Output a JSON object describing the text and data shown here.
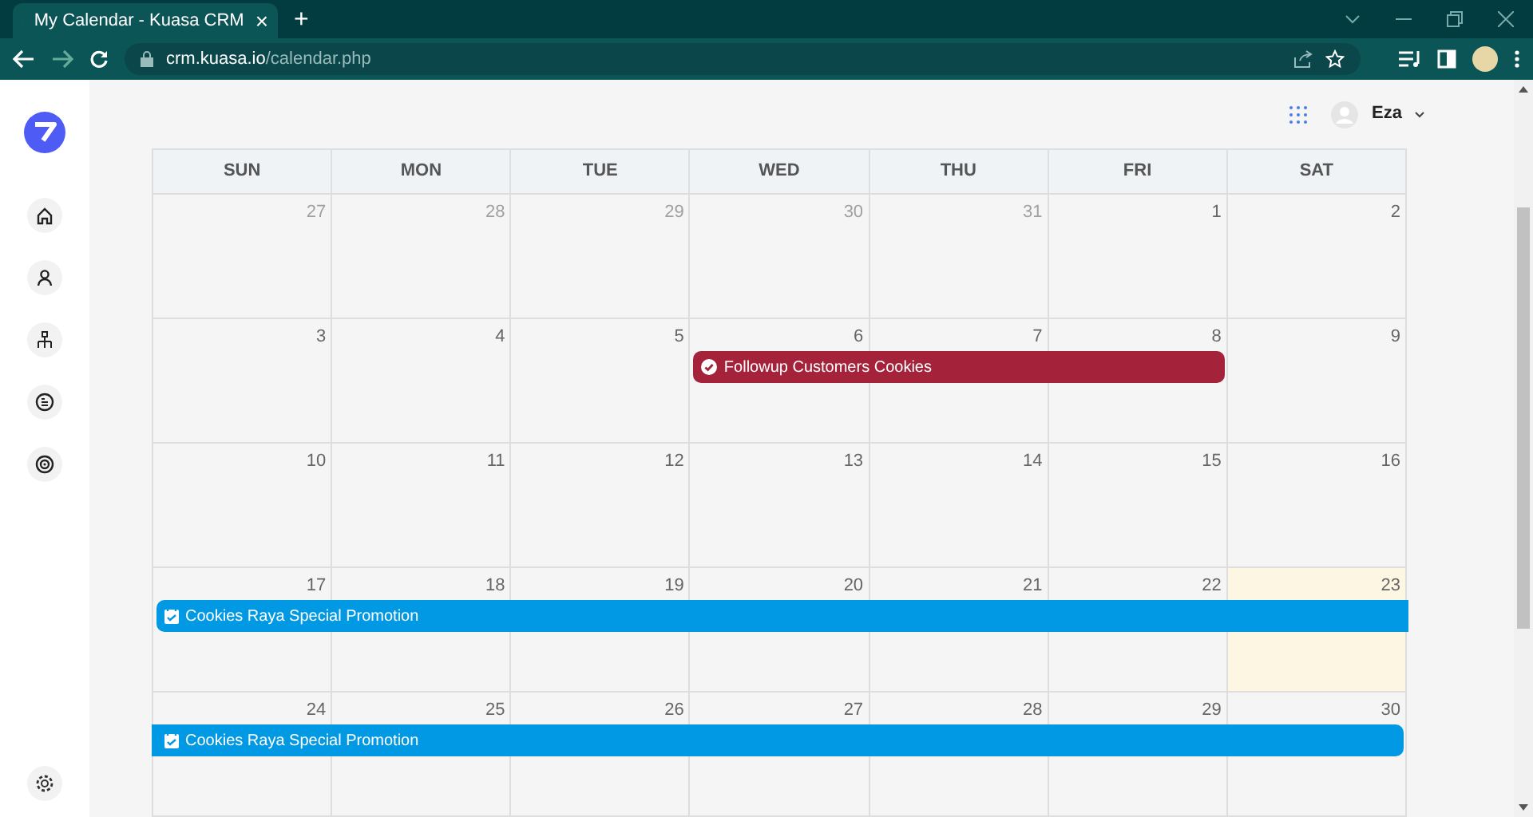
{
  "browser": {
    "tab_title": "My Calendar - Kuasa CRM",
    "tab_close": "×",
    "new_tab": "+",
    "url_host": "crm.kuasa.io",
    "url_path": "/calendar.php"
  },
  "sidebar": {
    "nav_items": [
      {
        "kind": "home"
      },
      {
        "kind": "person"
      },
      {
        "kind": "hierarchy"
      },
      {
        "kind": "document"
      },
      {
        "kind": "target"
      }
    ]
  },
  "header": {
    "user_name": "Eza"
  },
  "calendar": {
    "weekdays": [
      "SUN",
      "MON",
      "TUE",
      "WED",
      "THU",
      "FRI",
      "SAT"
    ],
    "weeks": [
      {
        "days": [
          {
            "label": "27",
            "other_month": true,
            "today": false
          },
          {
            "label": "28",
            "other_month": true,
            "today": false
          },
          {
            "label": "29",
            "other_month": true,
            "today": false
          },
          {
            "label": "30",
            "other_month": true,
            "today": false
          },
          {
            "label": "31",
            "other_month": true,
            "today": false
          },
          {
            "label": "1",
            "other_month": false,
            "today": false
          },
          {
            "label": "2",
            "other_month": false,
            "today": false
          }
        ]
      },
      {
        "days": [
          {
            "label": "3",
            "other_month": false,
            "today": false
          },
          {
            "label": "4",
            "other_month": false,
            "today": false
          },
          {
            "label": "5",
            "other_month": false,
            "today": false
          },
          {
            "label": "6",
            "other_month": false,
            "today": false
          },
          {
            "label": "7",
            "other_month": false,
            "today": false
          },
          {
            "label": "8",
            "other_month": false,
            "today": false
          },
          {
            "label": "9",
            "other_month": false,
            "today": false
          }
        ],
        "events": [
          {
            "title": "Followup Customers Cookies",
            "kind": "task",
            "color": "#a4233b",
            "covers": [
              false,
              false,
              false,
              true,
              true,
              true,
              false
            ],
            "continues_before": false,
            "continues_after": false
          }
        ]
      },
      {
        "days": [
          {
            "label": "10",
            "other_month": false,
            "today": false
          },
          {
            "label": "11",
            "other_month": false,
            "today": false
          },
          {
            "label": "12",
            "other_month": false,
            "today": false
          },
          {
            "label": "13",
            "other_month": false,
            "today": false
          },
          {
            "label": "14",
            "other_month": false,
            "today": false
          },
          {
            "label": "15",
            "other_month": false,
            "today": false
          },
          {
            "label": "16",
            "other_month": false,
            "today": false
          }
        ]
      },
      {
        "days": [
          {
            "label": "17",
            "other_month": false,
            "today": false
          },
          {
            "label": "18",
            "other_month": false,
            "today": false
          },
          {
            "label": "19",
            "other_month": false,
            "today": false
          },
          {
            "label": "20",
            "other_month": false,
            "today": false
          },
          {
            "label": "21",
            "other_month": false,
            "today": false
          },
          {
            "label": "22",
            "other_month": false,
            "today": false
          },
          {
            "label": "23",
            "other_month": false,
            "today": true
          }
        ],
        "events": [
          {
            "title": "Cookies Raya Special Promotion",
            "kind": "promotion",
            "color": "#0299e4",
            "covers": [
              true,
              true,
              true,
              true,
              true,
              true,
              true
            ],
            "continues_before": false,
            "continues_after": true
          }
        ]
      },
      {
        "days": [
          {
            "label": "24",
            "other_month": false,
            "today": false
          },
          {
            "label": "25",
            "other_month": false,
            "today": false
          },
          {
            "label": "26",
            "other_month": false,
            "today": false
          },
          {
            "label": "27",
            "other_month": false,
            "today": false
          },
          {
            "label": "28",
            "other_month": false,
            "today": false
          },
          {
            "label": "29",
            "other_month": false,
            "today": false
          },
          {
            "label": "30",
            "other_month": false,
            "today": false
          }
        ],
        "events": [
          {
            "title": "Cookies Raya Special Promotion",
            "kind": "promotion",
            "color": "#0299e4",
            "covers": [
              true,
              true,
              true,
              true,
              true,
              true,
              true
            ],
            "continues_before": true,
            "continues_after": false
          }
        ]
      }
    ]
  }
}
